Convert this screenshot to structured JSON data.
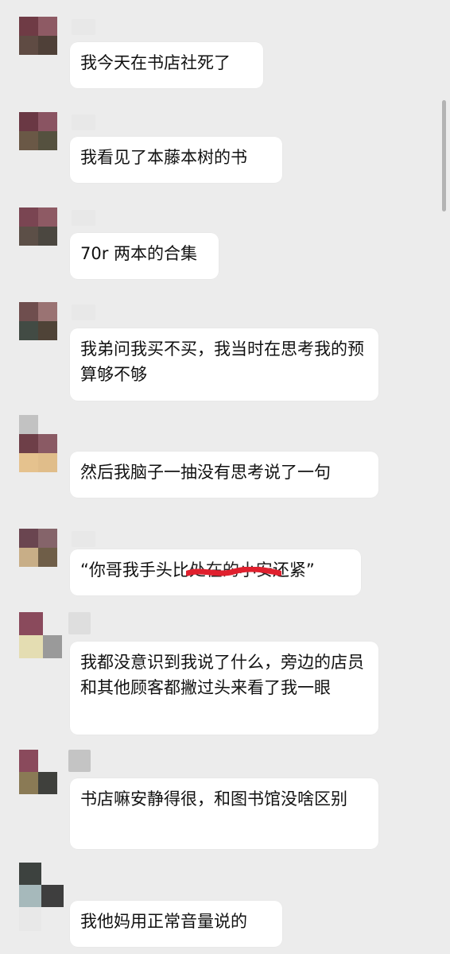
{
  "messages": [
    {
      "text": "我今天在书店社死了"
    },
    {
      "text": "我看见了本藤本树的书"
    },
    {
      "text": "70r 两本的合集"
    },
    {
      "text": "我弟问我买不买，我当时在思考我的预算够不够"
    },
    {
      "text": "然后我脑子一抽没有思考说了一句"
    },
    {
      "before": "“你哥我手头比",
      "struck": "处在的小安",
      "after": "还紧”"
    },
    {
      "text": "我都没意识到我说了什么，旁边的店员和其他顾客都撇过头来看了我一眼"
    },
    {
      "text": "书店嘛安静得很，和图书馆没啥区别"
    },
    {
      "text": "我他妈用正常音量说的"
    }
  ],
  "colors": {
    "background": "#ececec",
    "bubble": "#ffffff",
    "scribble": "#e0202e"
  }
}
